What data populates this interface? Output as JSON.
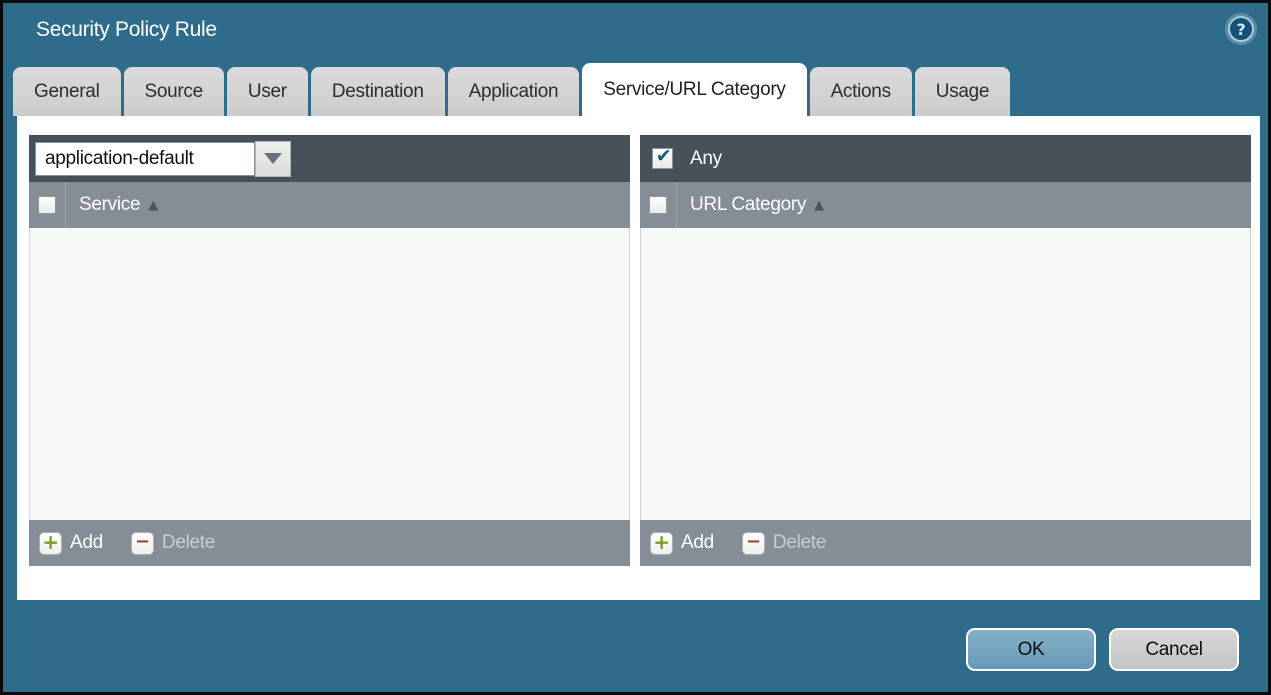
{
  "window": {
    "title": "Security Policy Rule"
  },
  "help_icon": {
    "glyph": "?"
  },
  "tabs": [
    {
      "label": "General",
      "active": false
    },
    {
      "label": "Source",
      "active": false
    },
    {
      "label": "User",
      "active": false
    },
    {
      "label": "Destination",
      "active": false
    },
    {
      "label": "Application",
      "active": false
    },
    {
      "label": "Service/URL Category",
      "active": true
    },
    {
      "label": "Actions",
      "active": false
    },
    {
      "label": "Usage",
      "active": false
    }
  ],
  "service_panel": {
    "dropdown_value": "application-default",
    "column_header": "Service",
    "sort_icon": "▲",
    "header_checkbox_checked": false,
    "add_label": "Add",
    "delete_label": "Delete",
    "delete_enabled": false
  },
  "url_category_panel": {
    "any_label": "Any",
    "any_checked": true,
    "column_header": "URL Category",
    "sort_icon": "▲",
    "header_checkbox_checked": false,
    "add_label": "Add",
    "delete_label": "Delete",
    "delete_enabled": false
  },
  "footer_buttons": {
    "ok_label": "OK",
    "cancel_label": "Cancel"
  },
  "icons": {
    "add_glyph": "+",
    "delete_glyph": "−",
    "check_glyph": "✔"
  },
  "colors": {
    "titlebar_teal": "#2F6C8B",
    "panel_toolbar_dark": "#46515A",
    "panel_header_gray": "#858E96",
    "ok_button_blue": "#74A3BE",
    "add_green": "#7CA01F",
    "delete_red": "#9B4038",
    "check_blue": "#1E5A7E"
  }
}
